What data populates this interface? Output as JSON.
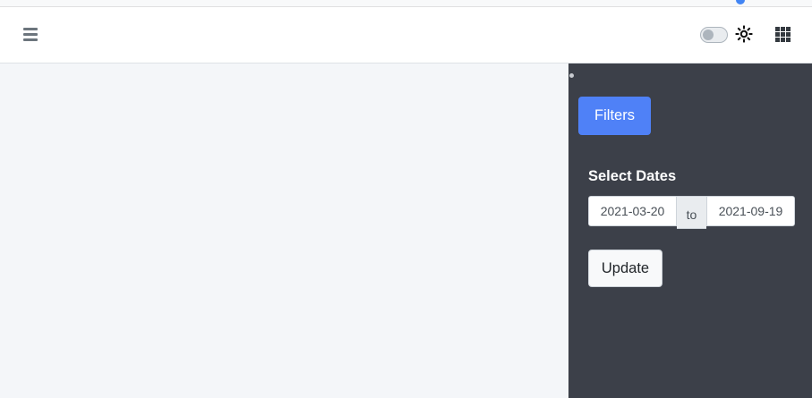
{
  "navbar": {
    "menu_icon": "hamburger-icon",
    "theme_toggle_state": "off",
    "theme_icon": "sun-icon",
    "apps_icon": "grid-icon"
  },
  "sidebar": {
    "filters_button_label": "Filters",
    "select_dates_label": "Select Dates",
    "date_from": "2021-03-20",
    "date_separator": "to",
    "date_to": "2021-09-19",
    "update_button_label": "Update"
  },
  "colors": {
    "primary": "#4f81f7",
    "sidebar_bg": "#3c4049",
    "content_bg": "#f4f6f9"
  }
}
